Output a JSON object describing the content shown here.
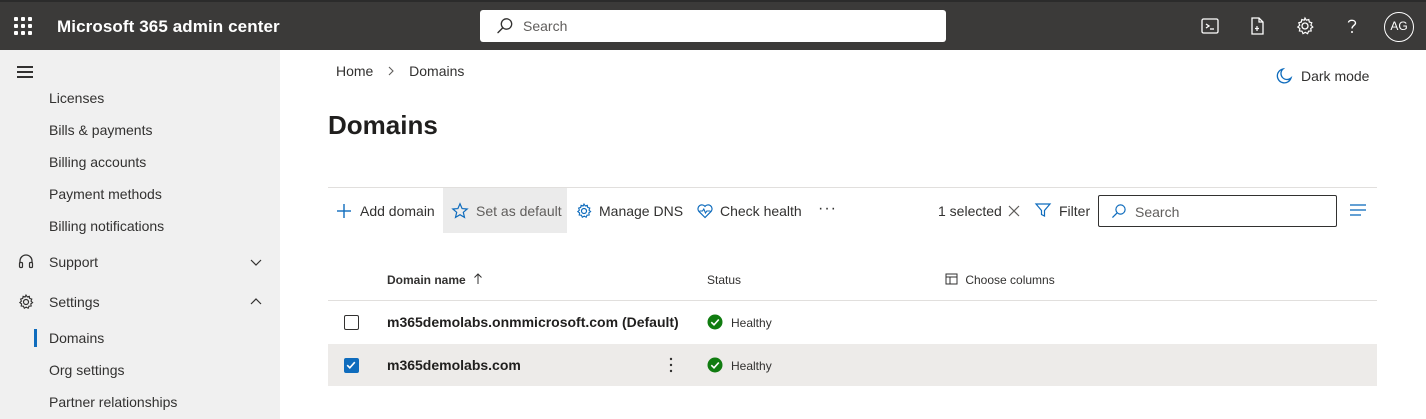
{
  "app": {
    "title": "Microsoft 365 admin center",
    "avatar_initials": "AG"
  },
  "top_search": {
    "placeholder": "Search"
  },
  "topbar_icons": [
    "terminal-icon",
    "document-icon",
    "gear-icon",
    "help-icon"
  ],
  "nav": {
    "items": [
      {
        "label": "Licenses"
      },
      {
        "label": "Bills & payments"
      },
      {
        "label": "Billing accounts"
      },
      {
        "label": "Payment methods"
      },
      {
        "label": "Billing notifications"
      },
      {
        "label": "Support"
      },
      {
        "label": "Settings"
      },
      {
        "label": "Domains",
        "active": true
      },
      {
        "label": "Org settings"
      },
      {
        "label": "Partner relationships"
      }
    ]
  },
  "breadcrumb": {
    "home": "Home",
    "current": "Domains"
  },
  "dark_mode_label": "Dark mode",
  "page_title": "Domains",
  "commands": {
    "add_domain": "Add domain",
    "set_default": "Set as default",
    "manage_dns": "Manage DNS",
    "check_health": "Check health",
    "more": "···",
    "selected": "1 selected",
    "filter": "Filter",
    "search_placeholder": "Search"
  },
  "table": {
    "columns": {
      "domain": "Domain name",
      "status": "Status",
      "choose": "Choose columns"
    },
    "rows": [
      {
        "domain": "m365demolabs.onmmicrosoft.com (Default)",
        "status": "Healthy",
        "checked": false
      },
      {
        "domain": "m365demolabs.com",
        "status": "Healthy",
        "checked": true
      }
    ]
  },
  "colors": {
    "topbar": "#3b3a39",
    "accent": "#0f6cbd",
    "healthy": "#107c10",
    "nav_bg": "#f0f0f0"
  }
}
